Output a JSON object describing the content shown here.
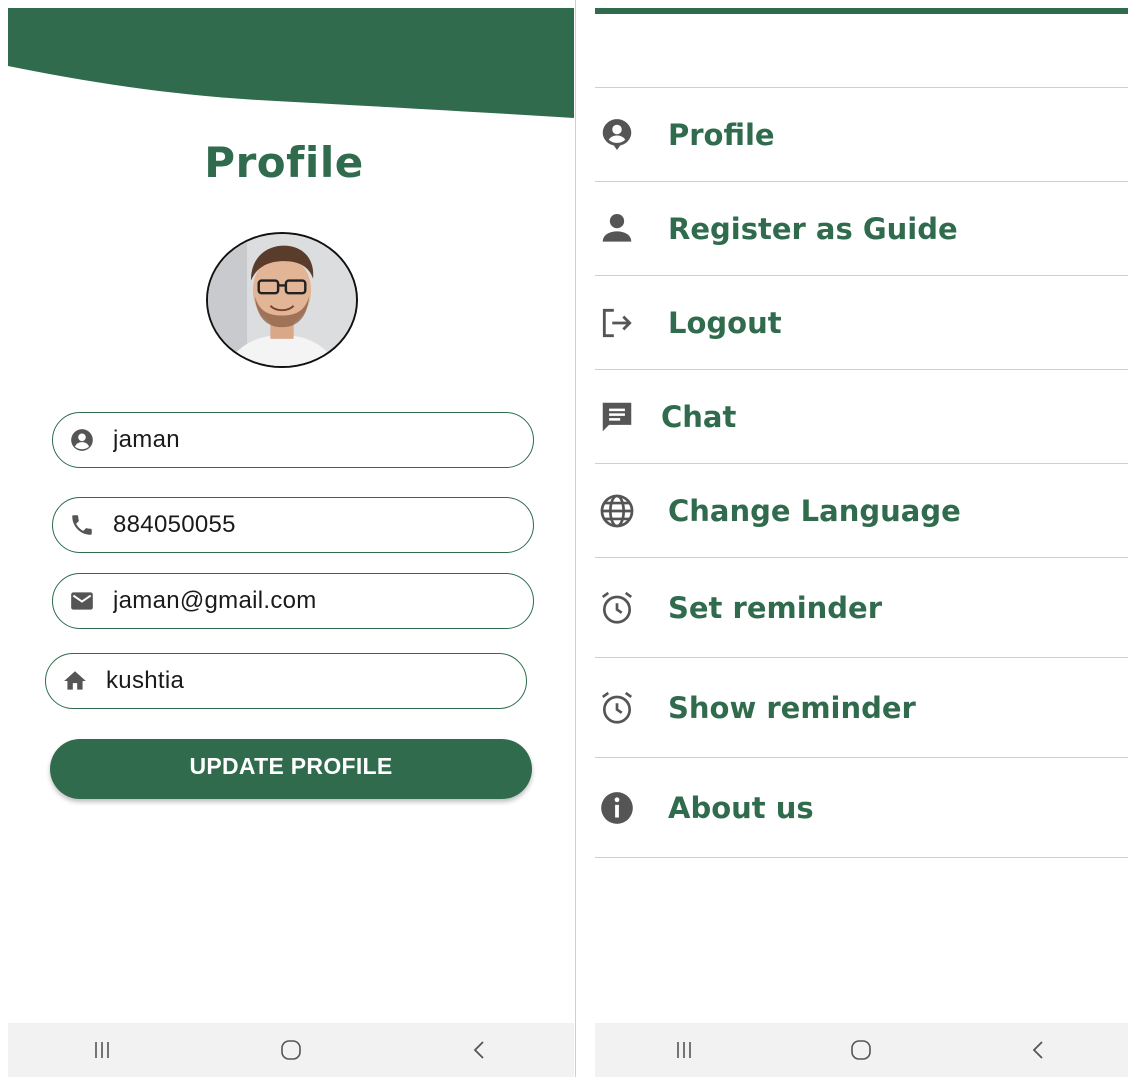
{
  "colors": {
    "brand": "#2f6b4c",
    "icon": "#555555",
    "divider": "#cfcfcf",
    "navbar": "#f2f2f2"
  },
  "profile_screen": {
    "title": "Profile",
    "fields": {
      "name": {
        "value": "jaman",
        "icon": "account-circle-icon"
      },
      "phone": {
        "value": "884050055",
        "icon": "phone-icon"
      },
      "email": {
        "value": "jaman@gmail.com",
        "icon": "mail-icon"
      },
      "address": {
        "value": "kushtia",
        "icon": "home-icon"
      }
    },
    "update_button": "UPDATE PROFILE"
  },
  "menu_screen": {
    "items": [
      {
        "label": "Profile",
        "icon": "account-pin-icon"
      },
      {
        "label": "Register as Guide",
        "icon": "person-icon"
      },
      {
        "label": "Logout",
        "icon": "logout-icon"
      },
      {
        "label": "Chat",
        "icon": "chat-icon"
      },
      {
        "label": "Change Language",
        "icon": "globe-icon"
      },
      {
        "label": "Set reminder",
        "icon": "alarm-icon"
      },
      {
        "label": "Show reminder",
        "icon": "alarm-icon"
      },
      {
        "label": "About us",
        "icon": "info-icon"
      }
    ]
  },
  "system_nav": {
    "buttons": [
      "recents-icon",
      "home-button-icon",
      "back-icon"
    ]
  }
}
